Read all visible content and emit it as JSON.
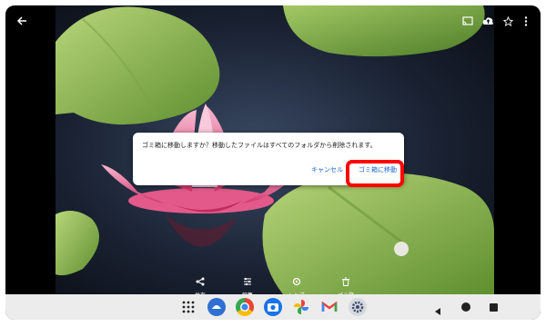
{
  "dialog": {
    "message": "ゴミ箱に移動しますか？移動したファイルはすべてのフォルダから削除されます。",
    "cancel_label": "キャンセル",
    "confirm_label": "ゴミ箱に移動"
  },
  "actions": [
    {
      "label": "共有",
      "icon": "share-icon"
    },
    {
      "label": "編集",
      "icon": "tune-icon"
    },
    {
      "label": "レンズ",
      "icon": "lens-icon"
    },
    {
      "label": "ゴミ箱",
      "icon": "trash-icon"
    }
  ],
  "topbar_icons": [
    "back-arrow-icon",
    "cast-icon",
    "cloud-upload-icon",
    "star-icon",
    "more-vert-icon"
  ],
  "dock_apps": [
    "app-drawer-icon",
    "assistant-app-icon",
    "chrome-app-icon",
    "camera-app-icon",
    "photos-app-icon",
    "gmail-app-icon",
    "settings-app-icon"
  ],
  "nav_buttons": [
    "back-icon",
    "home-icon",
    "recents-icon"
  ],
  "colors": {
    "highlight": "#ff0000",
    "dialog_button": "#1a66d0"
  }
}
